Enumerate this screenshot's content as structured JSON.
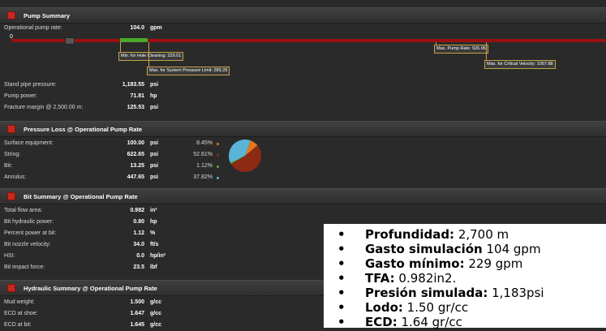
{
  "pump_summary": {
    "title": "Pump Summary",
    "operational_rate": {
      "label": "Operational pump rate:",
      "value": "104.0",
      "unit": "gpm"
    },
    "scale_zero": "0",
    "markers": {
      "min_hole_cleaning": "Min. for Hole Cleaning: 229.01",
      "max_system_pressure": "Max. for System Pressure Limit: 289.28",
      "max_pump_rate": "Max. Pump Rate: 926.96",
      "max_critical_velocity": "Max. for Critical Velocity: 1057.88"
    },
    "rows": [
      {
        "label": "Stand pipe pressure:",
        "value": "1,183.55",
        "unit": "psi"
      },
      {
        "label": "Pump power:",
        "value": "71.81",
        "unit": "hp"
      },
      {
        "label": "Fracture margin @ 2,500.00 m:",
        "value": "125.53",
        "unit": "psi"
      }
    ]
  },
  "pressure_loss": {
    "title": "Pressure Loss @ Operational Pump Rate",
    "rows": [
      {
        "label": "Surface equipment:",
        "value": "100.00",
        "unit": "psi",
        "pct": "8.45%",
        "color": "#e07a1f"
      },
      {
        "label": "String:",
        "value": "622.65",
        "unit": "psi",
        "pct": "52.61%",
        "color": "#8c2a14"
      },
      {
        "label": "Bit:",
        "value": "13.25",
        "unit": "psi",
        "pct": "1.12%",
        "color": "#5aa832"
      },
      {
        "label": "Annulus:",
        "value": "447.65",
        "unit": "psi",
        "pct": "37.82%",
        "color": "#5ab4d6"
      }
    ]
  },
  "bit_summary": {
    "title": "Bit Summary @ Operational Pump Rate",
    "rows": [
      {
        "label": "Total flow area:",
        "value": "0.982",
        "unit": "in²"
      },
      {
        "label": "Bit hydraulic power:",
        "value": "0.80",
        "unit": "hp"
      },
      {
        "label": "Percent power at bit:",
        "value": "1.12",
        "unit": "%"
      },
      {
        "label": "Bit nozzle velocity:",
        "value": "34.0",
        "unit": "ft/s"
      },
      {
        "label": "HSI:",
        "value": "0.0",
        "unit": "hp/in²"
      },
      {
        "label": "Bit impact force:",
        "value": "23.5",
        "unit": "lbf"
      }
    ]
  },
  "hydraulic_summary": {
    "title": "Hydraulic Summary @ Operational Pump Rate",
    "rows": [
      {
        "label": "Mud weight:",
        "value": "1.500",
        "unit": "g/cc"
      },
      {
        "label": "ECD at shoe:",
        "value": "1.647",
        "unit": "g/cc"
      },
      {
        "label": "ECD at bit:",
        "value": "1.645",
        "unit": "g/cc"
      }
    ]
  },
  "overlay": {
    "items": [
      {
        "bold": "Profundidad:",
        "text": " 2,700 m"
      },
      {
        "bold": "Gasto simulación",
        "text": " 104 gpm"
      },
      {
        "bold": "Gasto mínimo:",
        "text": " 229 gpm"
      },
      {
        "bold": "TFA:",
        "text": " 0.982in2."
      },
      {
        "bold": "Presión simulada:",
        "text": " 1,183psi"
      },
      {
        "bold": "Lodo:",
        "text": " 1.50 gr/cc"
      },
      {
        "bold": "ECD:",
        "text": " 1.64 gr/cc"
      }
    ]
  }
}
